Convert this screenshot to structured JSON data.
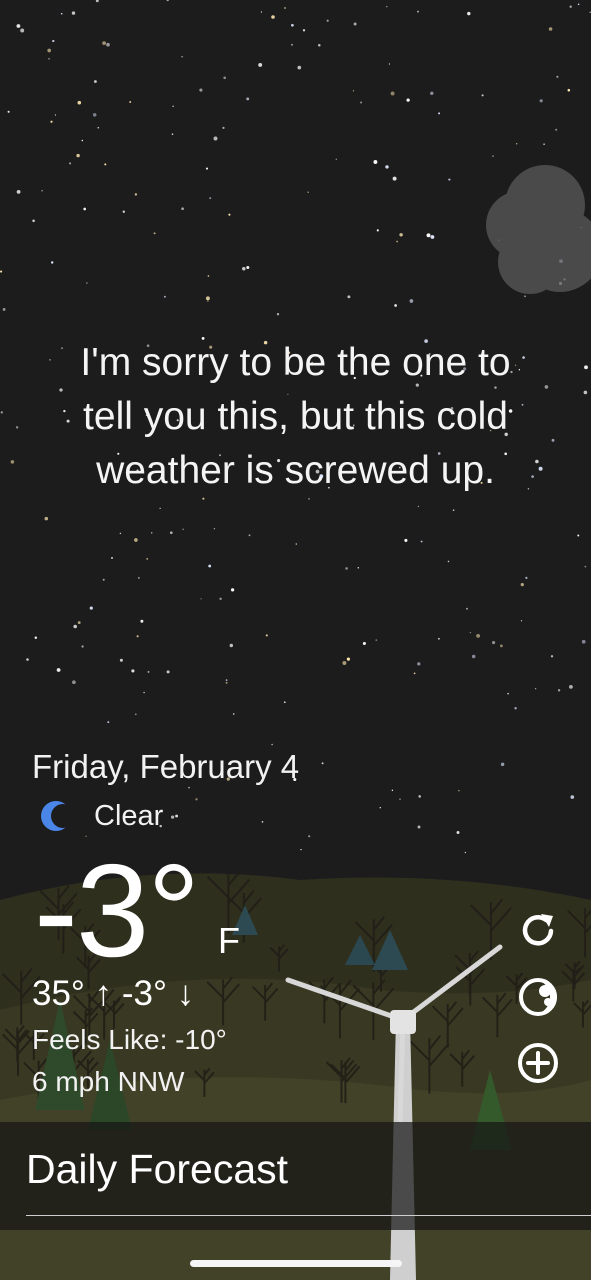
{
  "message": {
    "line1": "I'm sorry to be the one to",
    "line2": "tell you this, but this cold",
    "line3": "weather is screwed up."
  },
  "weather": {
    "date": "Friday, February 4",
    "condition": "Clear",
    "condition_icon": "moon-icon",
    "temperature": "-3°",
    "unit": "F",
    "hi_lo": "35° ↑  -3° ↓",
    "feels_like": "Feels Like: -10°",
    "wind": "6 mph NNW"
  },
  "actions": {
    "refresh_icon": "refresh-icon",
    "theme_icon": "moon-toggle-icon",
    "add_icon": "add-icon"
  },
  "forecast": {
    "title": "Daily Forecast"
  },
  "colors": {
    "sky": "#1d1c1d",
    "hills": "#3a3a24",
    "moon": "#4a86e8"
  }
}
